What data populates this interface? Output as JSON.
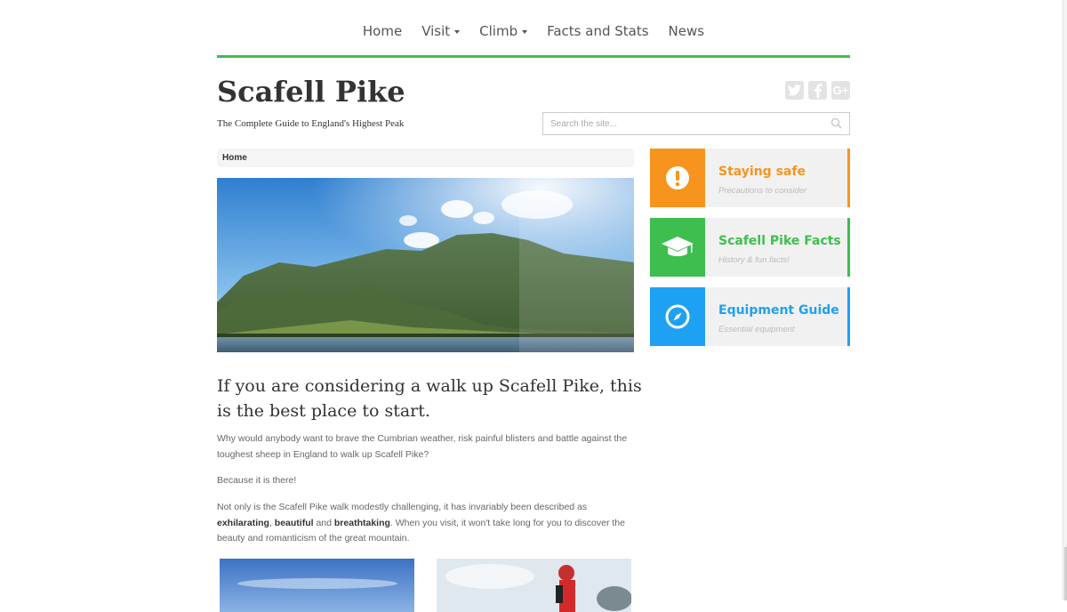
{
  "nav": {
    "items": [
      {
        "label": "Home",
        "dropdown": false
      },
      {
        "label": "Visit",
        "dropdown": true
      },
      {
        "label": "Climb",
        "dropdown": true
      },
      {
        "label": "Facts and Stats",
        "dropdown": false
      },
      {
        "label": "News",
        "dropdown": false
      }
    ]
  },
  "header": {
    "title": "Scafell Pike",
    "tagline": "The Complete Guide to England's Highest Peak",
    "social": {
      "twitter": "twitter-icon",
      "facebook": "facebook-icon",
      "googleplus_label": "G+"
    }
  },
  "search": {
    "placeholder": "Search the site..."
  },
  "breadcrumb": {
    "home": "Home"
  },
  "article": {
    "headline": "If you are considering a walk up Scafell Pike, this is the best place to start.",
    "p1": "Why would anybody want to brave the Cumbrian weather, risk painful blisters and battle against the toughest sheep in England to walk up Scafell Pike?",
    "p2": "Because it is there!",
    "p3_a": "Not only is the Scafell Pike walk modestly challenging, it has invariably been described as ",
    "p3_b": "exhilarating",
    "p3_c": ", ",
    "p3_d": "beautiful",
    "p3_e": " and ",
    "p3_f": "breathtaking",
    "p3_g": ". When you visit, it won't take long for you to discover the beauty and romanticism of the great mountain."
  },
  "sidebar": {
    "cards": [
      {
        "title": "Staying safe",
        "subtitle": "Precautions to consider",
        "icon": "exclamation-icon",
        "color": "#f7941d"
      },
      {
        "title": "Scafell Pike Facts",
        "subtitle": "History & fun facts!",
        "icon": "graduation-cap-icon",
        "color": "#3dbe4e"
      },
      {
        "title": "Equipment Guide",
        "subtitle": "Essential equipment",
        "icon": "compass-icon",
        "color": "#1ea1f2"
      }
    ]
  },
  "colors": {
    "accent_green": "#3dbe4e",
    "orange": "#f7941d",
    "blue": "#1ea1f2"
  }
}
